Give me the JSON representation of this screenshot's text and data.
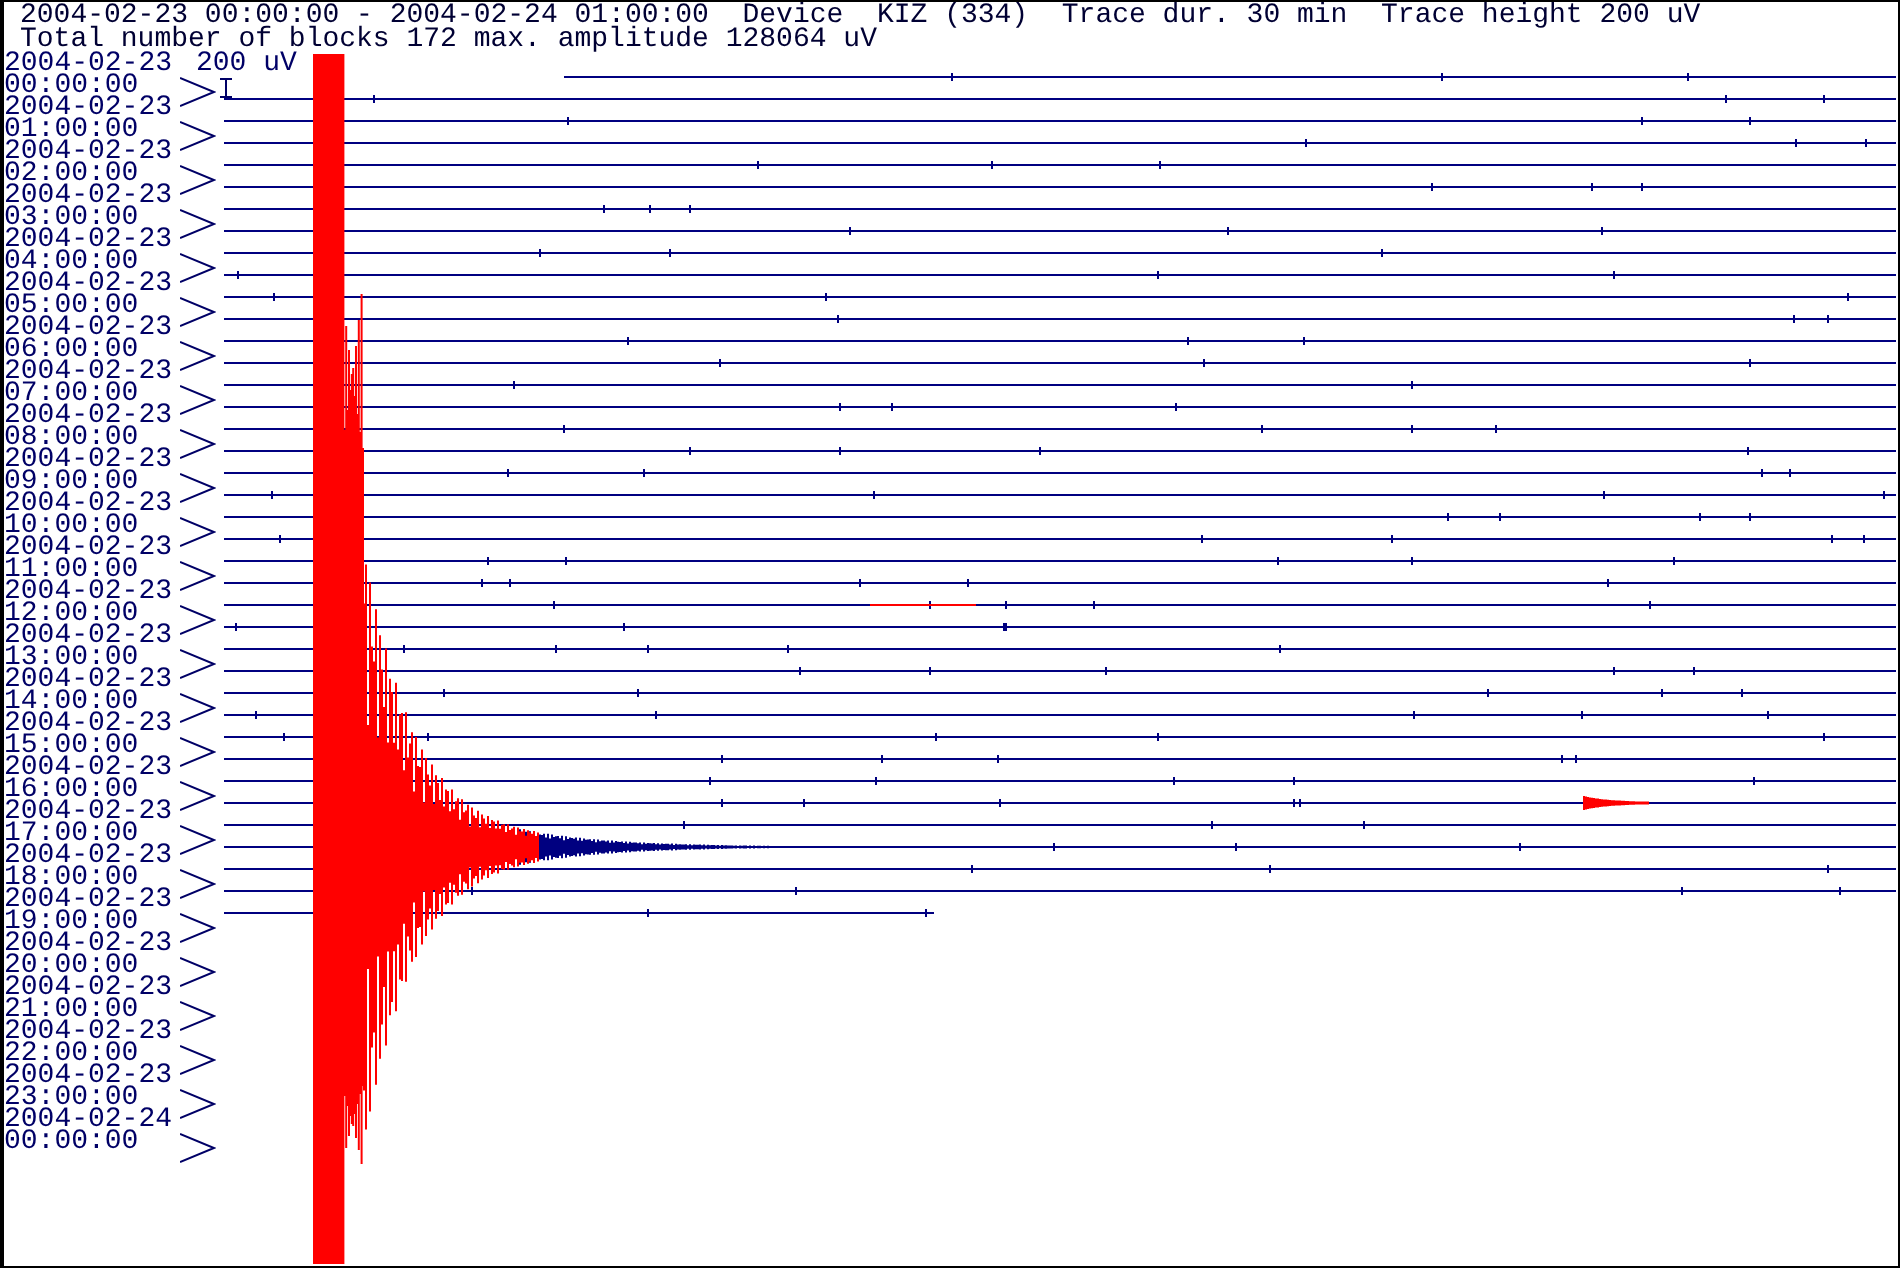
{
  "header": {
    "line_1": "2004-02-23 00:00:00 - 2004-02-24 01:00:00  Device  KIZ (334)  Trace dur. 30 min  Trace height 200 uV",
    "line_2": "Total number of blocks 172 max. amplitude 128064 uV"
  },
  "scale": {
    "label": "200 uV"
  },
  "hour_labels": [
    {
      "date": "2004-02-23",
      "time": "00:00:00"
    },
    {
      "date": "2004-02-23",
      "time": "01:00:00"
    },
    {
      "date": "2004-02-23",
      "time": "02:00:00"
    },
    {
      "date": "2004-02-23",
      "time": "03:00:00"
    },
    {
      "date": "2004-02-23",
      "time": "04:00:00"
    },
    {
      "date": "2004-02-23",
      "time": "05:00:00"
    },
    {
      "date": "2004-02-23",
      "time": "06:00:00"
    },
    {
      "date": "2004-02-23",
      "time": "07:00:00"
    },
    {
      "date": "2004-02-23",
      "time": "08:00:00"
    },
    {
      "date": "2004-02-23",
      "time": "09:00:00"
    },
    {
      "date": "2004-02-23",
      "time": "10:00:00"
    },
    {
      "date": "2004-02-23",
      "time": "11:00:00"
    },
    {
      "date": "2004-02-23",
      "time": "12:00:00"
    },
    {
      "date": "2004-02-23",
      "time": "13:00:00"
    },
    {
      "date": "2004-02-23",
      "time": "14:00:00"
    },
    {
      "date": "2004-02-23",
      "time": "15:00:00"
    },
    {
      "date": "2004-02-23",
      "time": "16:00:00"
    },
    {
      "date": "2004-02-23",
      "time": "17:00:00"
    },
    {
      "date": "2004-02-23",
      "time": "18:00:00"
    },
    {
      "date": "2004-02-23",
      "time": "19:00:00"
    },
    {
      "date": "2004-02-23",
      "time": "20:00:00"
    },
    {
      "date": "2004-02-23",
      "time": "21:00:00"
    },
    {
      "date": "2004-02-23",
      "time": "22:00:00"
    },
    {
      "date": "2004-02-23",
      "time": "23:00:00"
    },
    {
      "date": "2004-02-24",
      "time": "00:00:00"
    }
  ]
}
